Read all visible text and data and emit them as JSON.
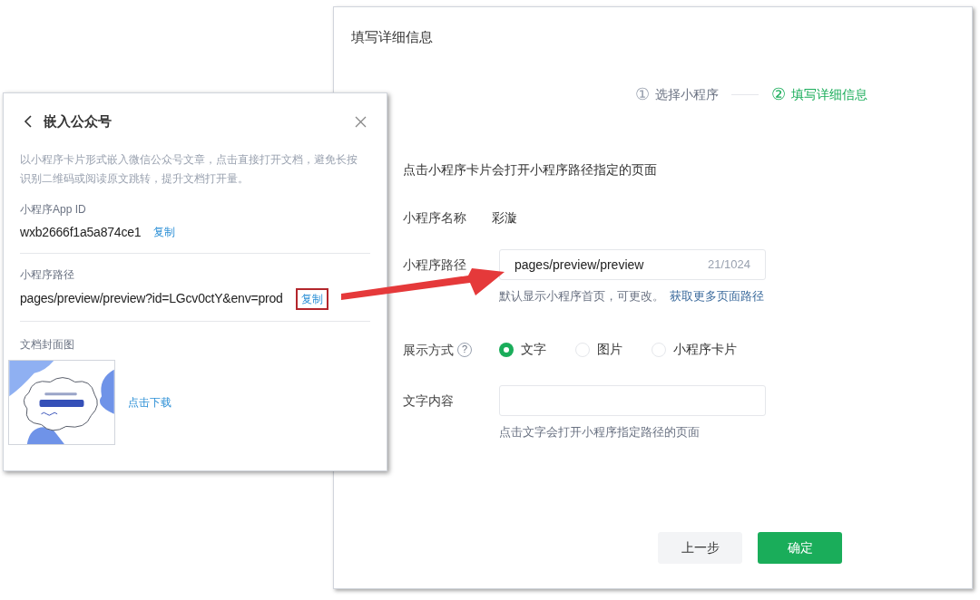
{
  "main_dialog": {
    "title": "填写详细信息",
    "steps": [
      {
        "number": "①",
        "label": "选择小程序",
        "selected": false
      },
      {
        "number": "②",
        "label": "填写详细信息",
        "selected": true
      }
    ],
    "description": "点击小程序卡片会打开小程序路径指定的页面",
    "fields": [
      {
        "kind": "text",
        "label": "小程序名称",
        "value": "彩漩"
      },
      {
        "kind": "input",
        "label": "小程序路径",
        "value": "pages/preview/preview",
        "counter": "21/1024",
        "hint": "默认显示小程序首页，可更改。",
        "link": "获取更多页面路径"
      },
      {
        "kind": "radio",
        "label": "展示方式",
        "help": "?",
        "options": [
          {
            "label": "文字",
            "selected": true
          },
          {
            "label": "图片",
            "selected": false
          },
          {
            "label": "小程序卡片",
            "selected": false
          }
        ]
      },
      {
        "kind": "input",
        "label": "文字内容",
        "hint": "点击文字会打开小程序指定路径的页面"
      }
    ],
    "buttons": [
      {
        "label": "上一步",
        "kind": "default"
      },
      {
        "label": "确定",
        "kind": "primary"
      }
    ]
  },
  "embed_panel": {
    "title": "嵌入公众号",
    "description": "以小程序卡片形式嵌入微信公众号文章，点击直接打开文档，避免长按识别二维码或阅读原文跳转，提升文档打开量。",
    "sections": [
      {
        "label": "小程序App ID",
        "value": "wxb2666f1a5a874ce1",
        "action": "复制",
        "highlighted": false
      },
      {
        "label": "小程序路径",
        "value": "pages/preview/preview?id=LGcv0ctY&env=prod",
        "action": "复制",
        "highlighted": true
      }
    ],
    "cover": {
      "label": "文档封面图",
      "action": "点击下载"
    }
  }
}
